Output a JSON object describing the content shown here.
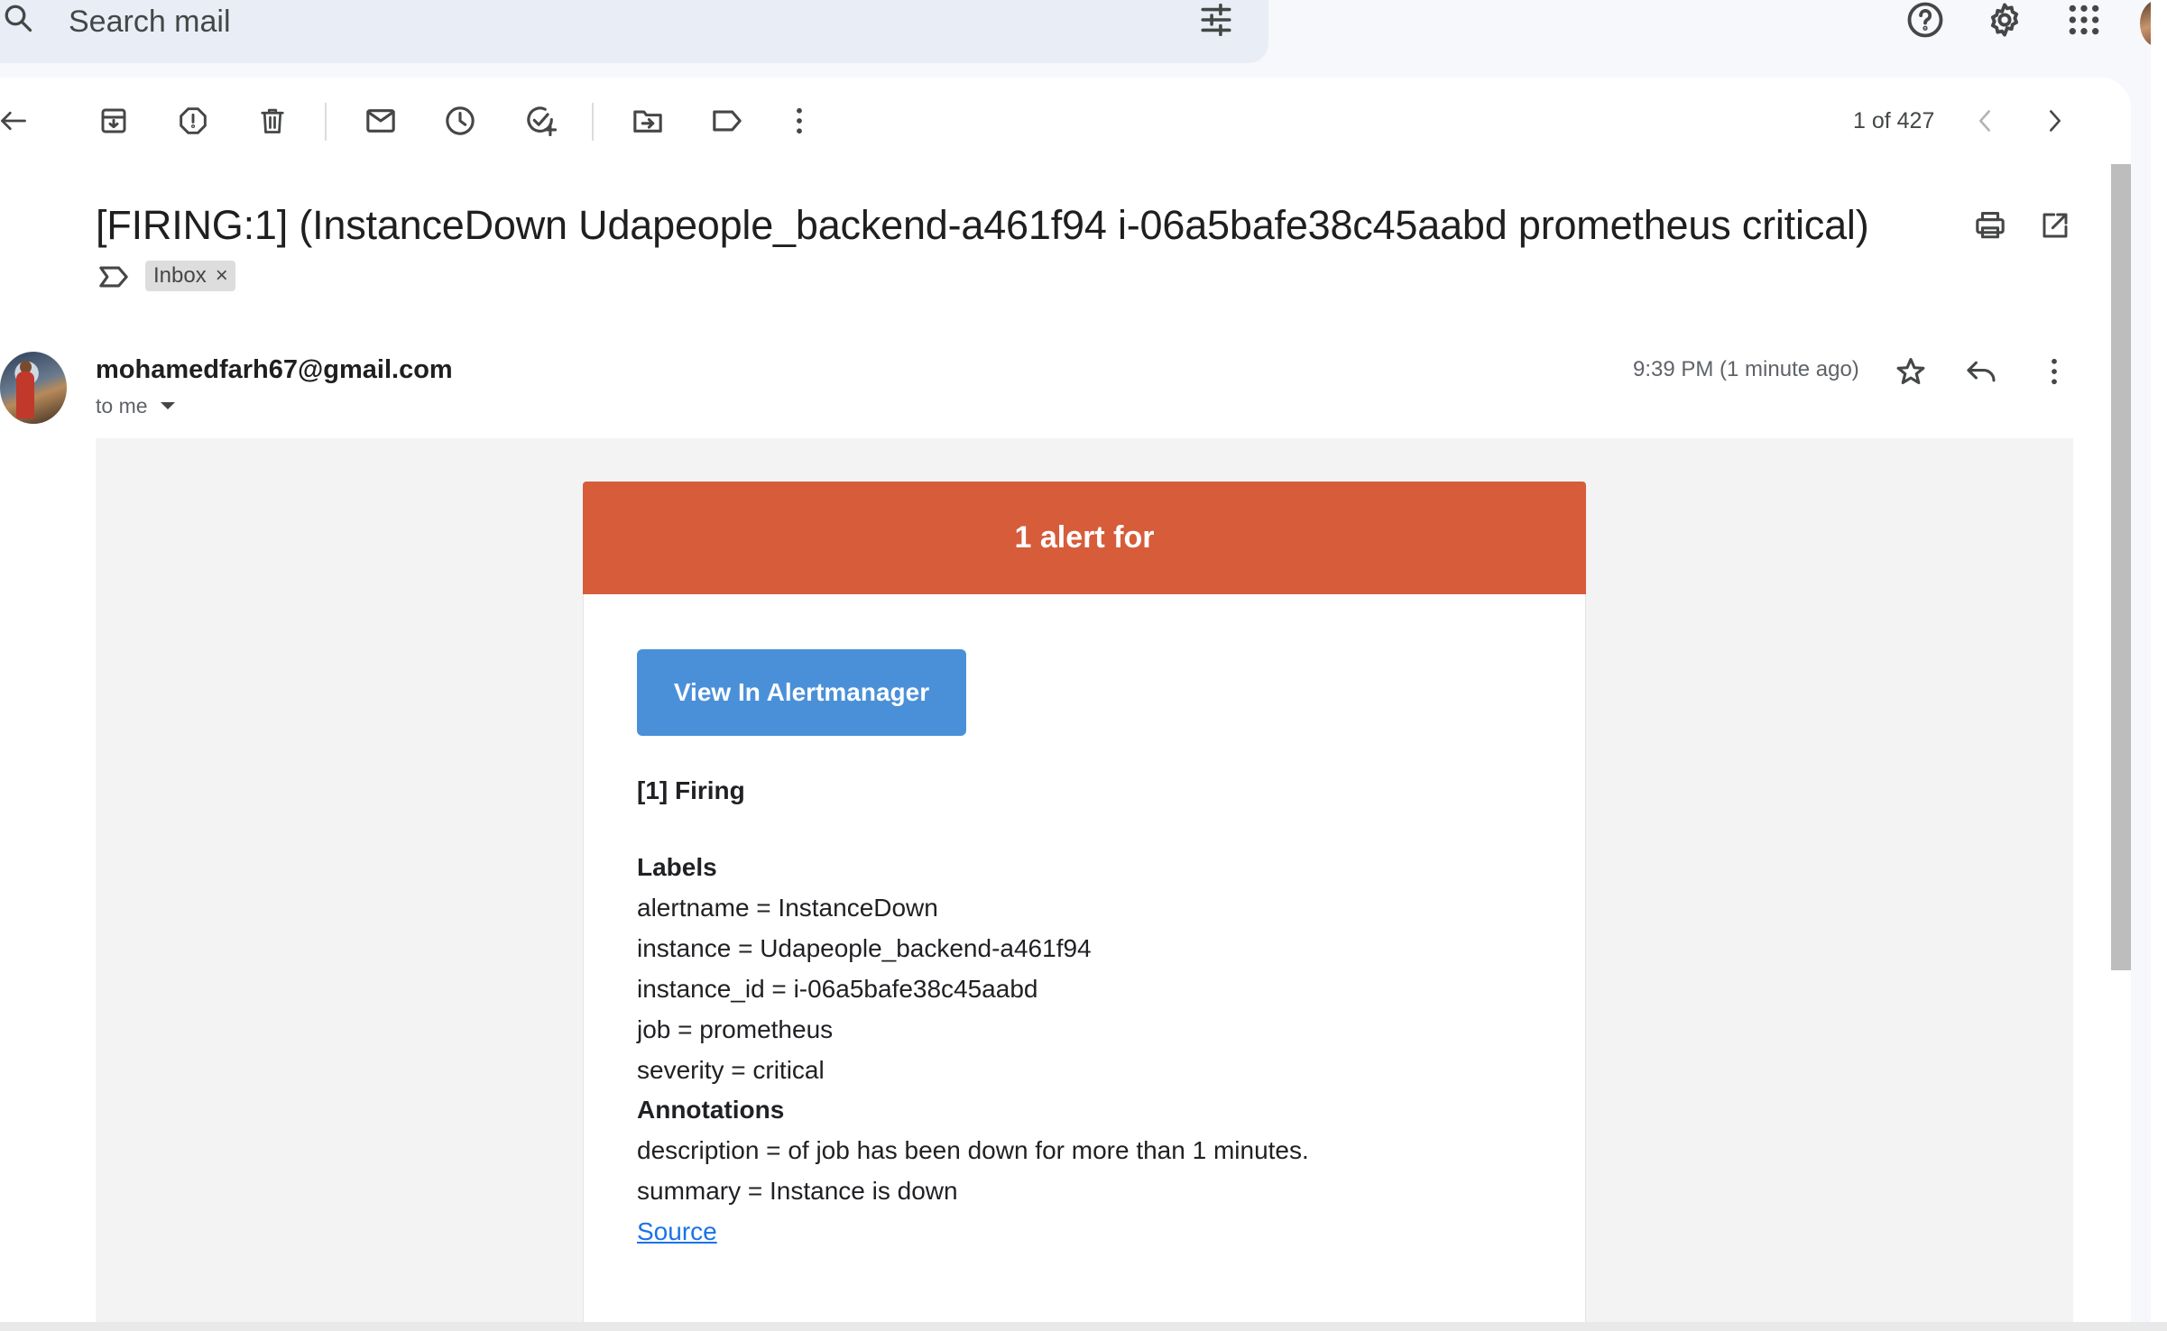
{
  "search": {
    "placeholder": "Search mail"
  },
  "toolbar": {
    "icons": [
      "back-arrow-icon",
      "archive-icon",
      "report-spam-icon",
      "delete-icon",
      "mark-unread-icon",
      "snooze-icon",
      "add-task-icon",
      "move-to-icon",
      "labels-icon",
      "more-vert-icon"
    ]
  },
  "pager": {
    "text": "1 of 427"
  },
  "message": {
    "subject": "[FIRING:1] (InstanceDown Udapeople_backend-a461f94 i-06a5bafe38c45aabd prometheus critical)",
    "label_chip": "Inbox",
    "label_chip_remove": "×",
    "sender": "mohamedfarh67@gmail.com",
    "recipient": "to me",
    "time": "9:39 PM (1 minute ago)"
  },
  "email_body": {
    "banner": "1 alert for",
    "button": "View In Alertmanager",
    "firing": "[1] Firing",
    "labels_heading": "Labels",
    "labels": [
      "alertname = InstanceDown",
      "instance = Udapeople_backend-a461f94",
      "instance_id = i-06a5bafe38c45aabd",
      "job = prometheus",
      "severity = critical"
    ],
    "annotations_heading": "Annotations",
    "annotations": [
      "description = of job has been down for more than 1 minutes.",
      "summary = Instance is down"
    ],
    "source_link": "Source"
  },
  "colors": {
    "banner": "#d75c3a",
    "button": "#4a90d9",
    "link": "#1a73e8",
    "search_bg": "#e9eef6"
  }
}
